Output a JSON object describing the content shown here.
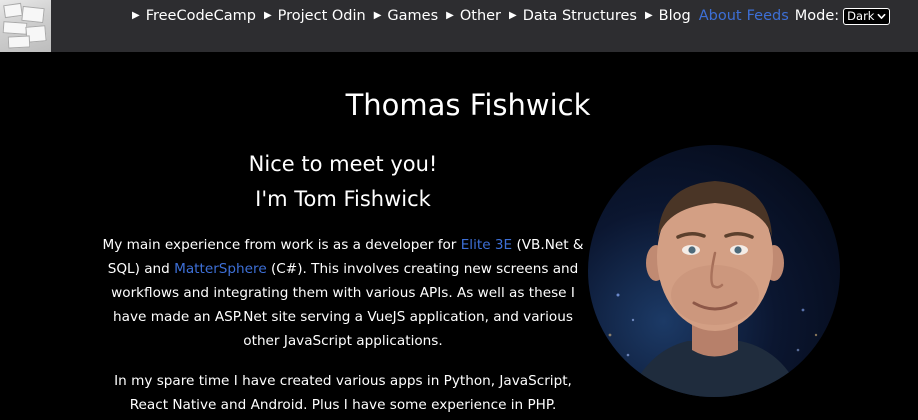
{
  "nav": {
    "items": [
      {
        "label": "FreeCodeCamp"
      },
      {
        "label": "Project Odin"
      },
      {
        "label": "Games"
      },
      {
        "label": "Other"
      },
      {
        "label": "Data Structures"
      }
    ],
    "blog_label": "Blog",
    "about_label": "About",
    "feeds_label": "Feeds",
    "mode_label": "Mode:",
    "mode_value": "Dark"
  },
  "page": {
    "title": "Thomas Fishwick",
    "greeting_line1": "Nice to meet you!",
    "greeting_line2": "I'm Tom Fishwick"
  },
  "bio": {
    "p1_before_elite": "My main experience from work is as a developer for ",
    "elite_link": "Elite 3E",
    "p1_between": " (VB.Net & SQL) and ",
    "mattersphere_link": "MatterSphere",
    "p1_after": " (C#). This involves creating new screens and workflows and integrating them with various APIs. As well as these I have made an ASP.Net site serving a VueJS application, and various other JavaScript applications.",
    "p2": "In my spare time I have created various apps in Python, JavaScript, React Native and Android. Plus I have some experience in PHP."
  },
  "colors": {
    "background": "#000000",
    "topbar": "#2d2d30",
    "link": "#3d6fd6",
    "text": "#ffffff"
  }
}
